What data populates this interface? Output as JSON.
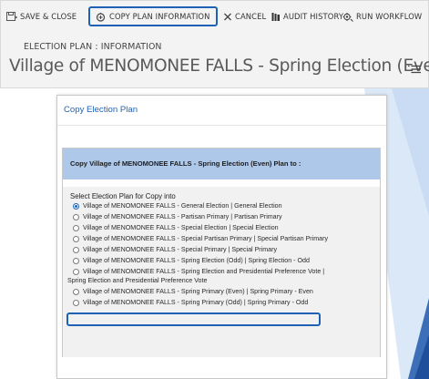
{
  "toolbar": {
    "save_close": "SAVE & CLOSE",
    "copy_plan": "COPY PLAN INFORMATION",
    "cancel": "CANCEL",
    "audit_history": "AUDIT HISTORY",
    "run_workflow": "RUN WORKFLOW"
  },
  "form": {
    "label": "ELECTION PLAN : INFORMATION",
    "title": "Village of MENOMONEE FALLS - Spring Election (Even)"
  },
  "dialog": {
    "title": "Copy Election Plan",
    "banner": "Copy Village of MENOMONEE FALLS - Spring Election (Even) Plan to :",
    "select_label": "Select Election Plan for Copy into",
    "options": [
      {
        "label": "Village of MENOMONEE FALLS - General Election | General Election",
        "checked": true
      },
      {
        "label": "Village of MENOMONEE FALLS - Partisan Primary | Partisan Primary",
        "checked": false
      },
      {
        "label": "Village of MENOMONEE FALLS - Special Election | Special Election",
        "checked": false
      },
      {
        "label": "Village of MENOMONEE FALLS - Special Partisan Primary | Special Partisan Primary",
        "checked": false
      },
      {
        "label": "Village of MENOMONEE FALLS - Special Primary | Special Primary",
        "checked": false
      },
      {
        "label": "Village of MENOMONEE FALLS - Spring Election (Odd) | Spring Election - Odd",
        "checked": false
      },
      {
        "label": "Village of MENOMONEE FALLS - Spring Election and Presidential Preference Vote |",
        "label_cont": "Spring Election and Presidential Preference Vote",
        "checked": false
      },
      {
        "label": "Village of MENOMONEE FALLS - Spring Primary (Even) | Spring Primary - Even",
        "checked": false
      },
      {
        "label": "Village of MENOMONEE FALLS - Spring Primary (Odd) | Spring Primary - Odd",
        "checked": false
      }
    ]
  },
  "colors": {
    "accent": "#1f62b5",
    "banner": "#aec8ea",
    "panel": "#f3f3f3",
    "options_bg": "#f1f1f1"
  },
  "icons": [
    "save-icon",
    "copy-icon",
    "close-icon",
    "audit-history-icon",
    "workflow-icon",
    "menu-list-icon"
  ]
}
